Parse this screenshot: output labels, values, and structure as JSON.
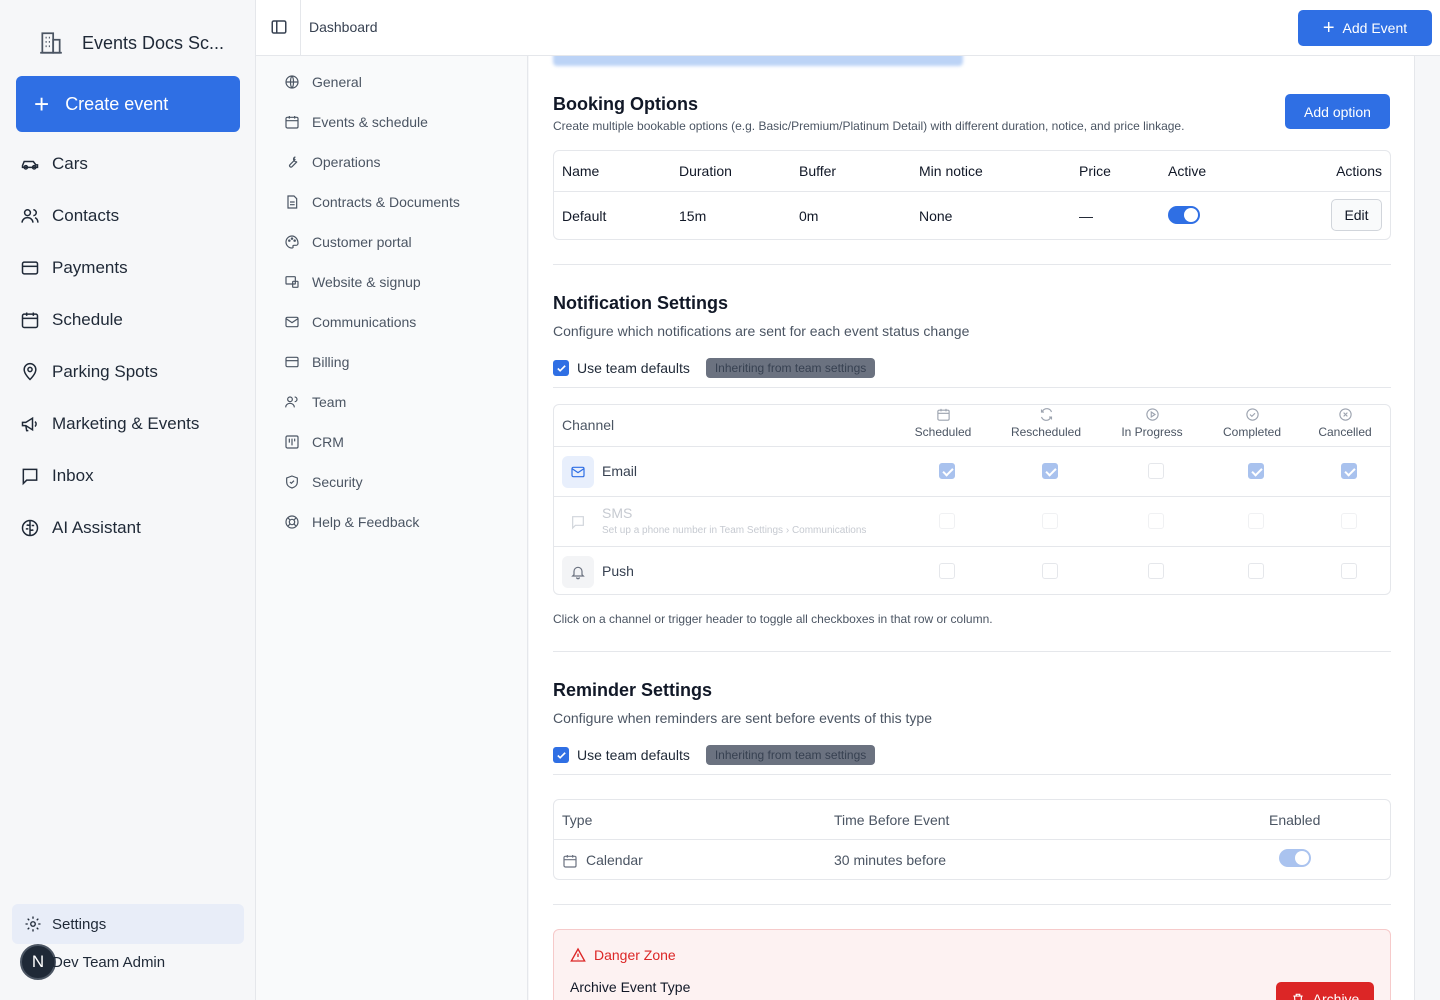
{
  "app": {
    "name": "Events Docs Sc...",
    "create_label": "Create event"
  },
  "nav": {
    "items": [
      {
        "label": "Cars",
        "icon": "car-icon"
      },
      {
        "label": "Contacts",
        "icon": "users-icon"
      },
      {
        "label": "Payments",
        "icon": "credit-card-icon"
      },
      {
        "label": "Schedule",
        "icon": "calendar-icon"
      },
      {
        "label": "Parking Spots",
        "icon": "map-pin-icon"
      },
      {
        "label": "Marketing & Events",
        "icon": "megaphone-icon"
      },
      {
        "label": "Inbox",
        "icon": "inbox-icon"
      },
      {
        "label": "AI Assistant",
        "icon": "brain-icon"
      }
    ],
    "settings_label": "Settings",
    "user_name": "Dev Team Admin",
    "user_initial": "N"
  },
  "topbar": {
    "title": "Dashboard",
    "add_event_label": "Add Event"
  },
  "settings_nav": {
    "items": [
      {
        "label": "General"
      },
      {
        "label": "Events & schedule"
      },
      {
        "label": "Operations"
      },
      {
        "label": "Contracts & Documents"
      },
      {
        "label": "Customer portal"
      },
      {
        "label": "Website & signup"
      },
      {
        "label": "Communications"
      },
      {
        "label": "Billing"
      },
      {
        "label": "Team"
      },
      {
        "label": "CRM"
      },
      {
        "label": "Security"
      },
      {
        "label": "Help & Feedback"
      }
    ]
  },
  "booking": {
    "title": "Booking Options",
    "description": "Create multiple bookable options (e.g. Basic/Premium/Platinum Detail) with different duration, notice, and price linkage.",
    "add_label": "Add option",
    "headers": {
      "name": "Name",
      "duration": "Duration",
      "buffer": "Buffer",
      "min_notice": "Min notice",
      "price": "Price",
      "active": "Active",
      "actions": "Actions"
    },
    "rows": [
      {
        "name": "Default",
        "duration": "15m",
        "buffer": "0m",
        "min_notice": "None",
        "price": "—",
        "active": true,
        "edit_label": "Edit"
      }
    ]
  },
  "notifications": {
    "title": "Notification Settings",
    "description": "Configure which notifications are sent for each event status change",
    "use_defaults_label": "Use team defaults",
    "badge": "Inheriting from team settings",
    "channel_header": "Channel",
    "triggers": [
      "Scheduled",
      "Rescheduled",
      "In Progress",
      "Completed",
      "Cancelled"
    ],
    "channels": [
      {
        "name": "Email",
        "checks": [
          true,
          true,
          false,
          true,
          true
        ]
      },
      {
        "name": "SMS",
        "sub": "Set up a phone number in Team Settings",
        "sub_link": "Communications",
        "checks": [
          false,
          false,
          false,
          false,
          false
        ]
      },
      {
        "name": "Push",
        "checks": [
          false,
          false,
          false,
          false,
          false
        ]
      }
    ],
    "hint": "Click on a channel or trigger header to toggle all checkboxes in that row or column."
  },
  "reminders": {
    "title": "Reminder Settings",
    "description": "Configure when reminders are sent before events of this type",
    "use_defaults_label": "Use team defaults",
    "badge": "Inheriting from team settings",
    "headers": {
      "type": "Type",
      "time": "Time Before Event",
      "enabled": "Enabled"
    },
    "rows": [
      {
        "type": "Calendar",
        "time": "30 minutes before",
        "enabled": true
      }
    ]
  },
  "danger": {
    "title": "Danger Zone",
    "subtitle": "Archive Event Type",
    "archive_label": "Archive"
  },
  "colors": {
    "primary": "#2f6fe4",
    "danger": "#dc2626"
  }
}
